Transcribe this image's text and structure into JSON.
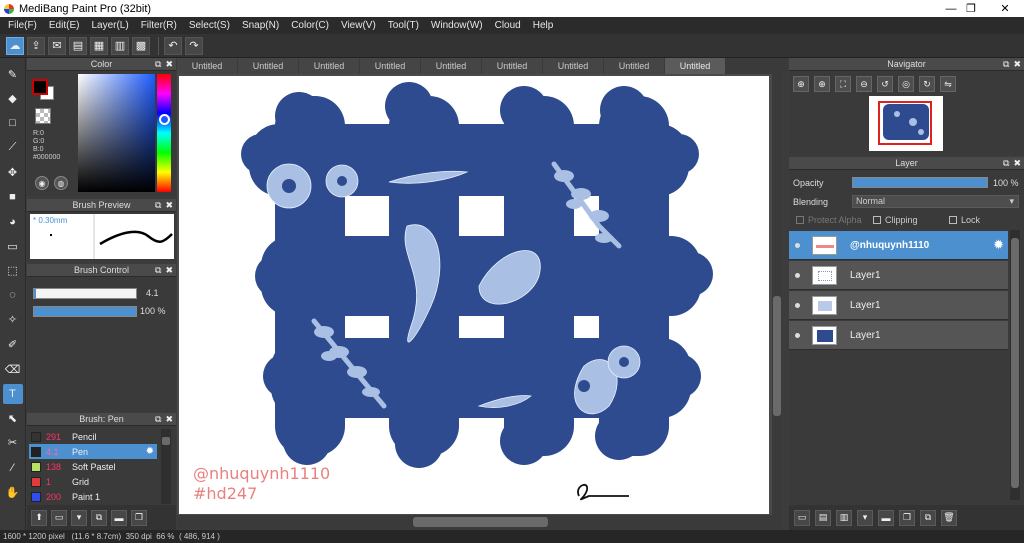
{
  "window": {
    "title": "MediBang Paint Pro (32bit)",
    "minimize": "—",
    "maximize": "❐",
    "close": "✕"
  },
  "menu": [
    "File(F)",
    "Edit(E)",
    "Layer(L)",
    "Filter(R)",
    "Select(S)",
    "Snap(N)",
    "Color(C)",
    "View(V)",
    "Tool(T)",
    "Window(W)",
    "Cloud",
    "Help"
  ],
  "color_panel": {
    "title": "Color",
    "r": "R:0",
    "g": "G:0",
    "b": "B:0",
    "hex": "#000000",
    "foreground": "#000000",
    "background": "#ffffff"
  },
  "brush_preview": {
    "title": "Brush Preview",
    "size": "* 0.30mm"
  },
  "brush_control": {
    "title": "Brush Control",
    "size_value": "4.1",
    "opacity_value": "100 %",
    "size_fraction": 0.02,
    "opacity_fraction": 1.0
  },
  "brush_list": {
    "title": "Brush: Pen",
    "items": [
      {
        "num": "291",
        "name": "Pencil",
        "color": "#333333"
      },
      {
        "num": "4.1",
        "name": "Pen",
        "color": "#222222"
      },
      {
        "num": "138",
        "name": "Soft Pastel",
        "color": "#b9e065"
      },
      {
        "num": "1",
        "name": "Grid",
        "color": "#e23b3b"
      },
      {
        "num": "200",
        "name": "Paint 1",
        "color": "#2f4cf0"
      }
    ]
  },
  "doc_tabs": [
    "Untitled",
    "Untitled",
    "Untitled",
    "Untitled",
    "Untitled",
    "Untitled",
    "Untitled",
    "Untitled",
    "Untitled"
  ],
  "canvas": {
    "watermark_line1": "@nhuquynh1110",
    "watermark_line2": "#hd247",
    "artwork_color": "#2d4b8e"
  },
  "navigator": {
    "title": "Navigator"
  },
  "layer_panel": {
    "title": "Layer",
    "opacity_label": "Opacity",
    "opacity_value": "100 %",
    "blending_label": "Blending",
    "blending_value": "Normal",
    "protect_alpha": "Protect Alpha",
    "clipping": "Clipping",
    "lock": "Lock",
    "layers": [
      {
        "name": "@nhuquynh1110"
      },
      {
        "name": "Layer1"
      },
      {
        "name": "Layer1"
      },
      {
        "name": "Layer1"
      }
    ]
  },
  "status": {
    "text": "1600 * 1200 pixel   (11.6 * 8.7cm)  350 dpi  66 %  ( 486, 914 )"
  },
  "accent_color": "#4c90cf"
}
